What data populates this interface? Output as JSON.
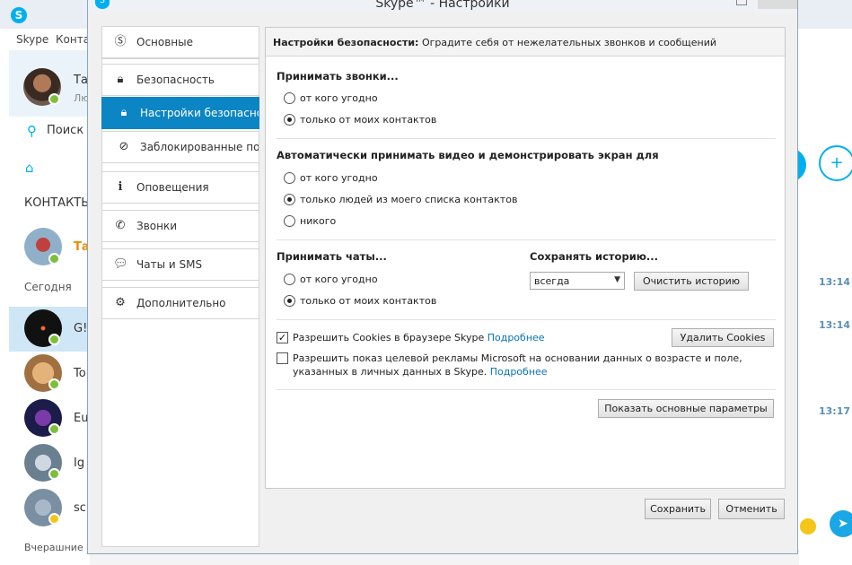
{
  "background_window": {
    "logo": "S",
    "menu": [
      "Skype",
      "Конта"
    ],
    "search_label": "Поиск",
    "contacts_header": "КОНТАКТЫ",
    "profile_name_fragment": "Та",
    "profile_status_fragment": "Лю",
    "favorite_name_fragment": "Та",
    "today_label": "Сегодня",
    "yesterday_label": "Вчерашние",
    "recent_names": [
      "G!",
      "To",
      "Eu",
      "Ig",
      "sc"
    ],
    "times": [
      "13:14",
      "13:14",
      "13:17"
    ]
  },
  "dialog": {
    "title": "Skype™ - Настройки",
    "nav": [
      {
        "label": "Основные",
        "icon": "skype-icon"
      },
      {
        "label": "Безопасность",
        "icon": "lock-icon"
      },
      {
        "label": "Настройки безопасно...",
        "icon": "lock-icon"
      },
      {
        "label": "Заблокированные по...",
        "icon": "blocked-icon"
      },
      {
        "label": "Оповещения",
        "icon": "info-icon"
      },
      {
        "label": "Звонки",
        "icon": "phone-icon"
      },
      {
        "label": "Чаты и SMS",
        "icon": "chat-icon"
      },
      {
        "label": "Дополнительно",
        "icon": "gear-icon"
      }
    ],
    "header_bold": "Настройки безопасности:",
    "header_text": " Оградите себя от нежелательных звонков и сообщений",
    "calls": {
      "title": "Принимать звонки...",
      "options": [
        "от кого угодно",
        "только от моих контактов"
      ],
      "selected": 1
    },
    "video": {
      "title": "Автоматически принимать видео и демонстрировать экран для",
      "options": [
        "от кого угодно",
        "только людей из моего списка контактов",
        "никого"
      ],
      "selected": 1
    },
    "chats": {
      "title": "Принимать чаты...",
      "options": [
        "от кого угодно",
        "только от моих контактов"
      ],
      "selected": 1
    },
    "history": {
      "title": "Сохранять историю...",
      "value": "всегда",
      "clear_button": "Очистить историю"
    },
    "cookies": {
      "label": "Разрешить Cookies в браузере Skype",
      "link": "Подробнее",
      "checked": true,
      "delete_button": "Удалить Cookies"
    },
    "ads": {
      "label": "Разрешить показ целевой рекламы Microsoft на основании данных о возрасте и поле, указанных в личных данных в Skype.",
      "link": "Подробнее",
      "checked": false
    },
    "show_basic_button": "Показать основные параметры",
    "save_button": "Сохранить",
    "cancel_button": "Отменить"
  }
}
